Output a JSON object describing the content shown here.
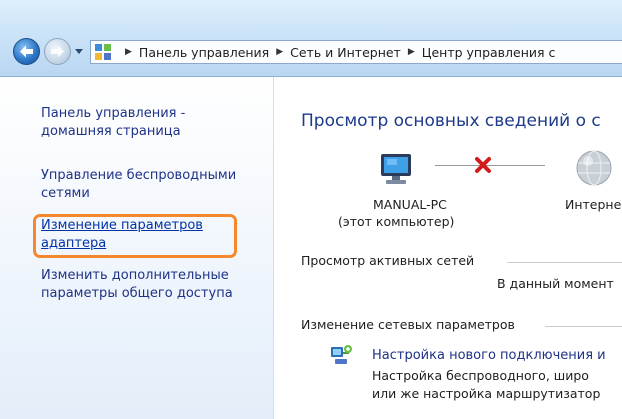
{
  "address_bar": {
    "breadcrumbs": [
      "Панель управления",
      "Сеть и Интернет",
      "Центр управления с"
    ]
  },
  "left_pane": {
    "links": [
      "Панель управления -",
      "домашняя страница",
      "Управление беспроводными",
      "сетями",
      "Изменение параметров",
      "адаптера",
      "Изменить дополнительные",
      "параметры общего доступа"
    ]
  },
  "main": {
    "title": "Просмотр основных сведений о с",
    "computer_name": "MANUAL-PC",
    "computer_sub": "(этот компьютер)",
    "internet_label": "Интерне",
    "active_networks_header": "Просмотр активных сетей",
    "no_networks_msg": "В данный момент",
    "change_settings_header": "Изменение сетевых параметров",
    "task_link": "Настройка нового подключения и",
    "task_desc_line1": "Настройка беспроводного, широ",
    "task_desc_line2": "или же настройка маршрутизатор"
  },
  "icons": [
    "back-arrow-icon",
    "forward-arrow-icon",
    "control-panel-icon",
    "computer-icon",
    "disconnected-x-icon",
    "globe-icon",
    "new-connection-icon"
  ],
  "colors": {
    "link": "#1e3287",
    "title": "#1e3a8a",
    "highlight": "#f5872d",
    "error_x": "#d31b1b"
  }
}
